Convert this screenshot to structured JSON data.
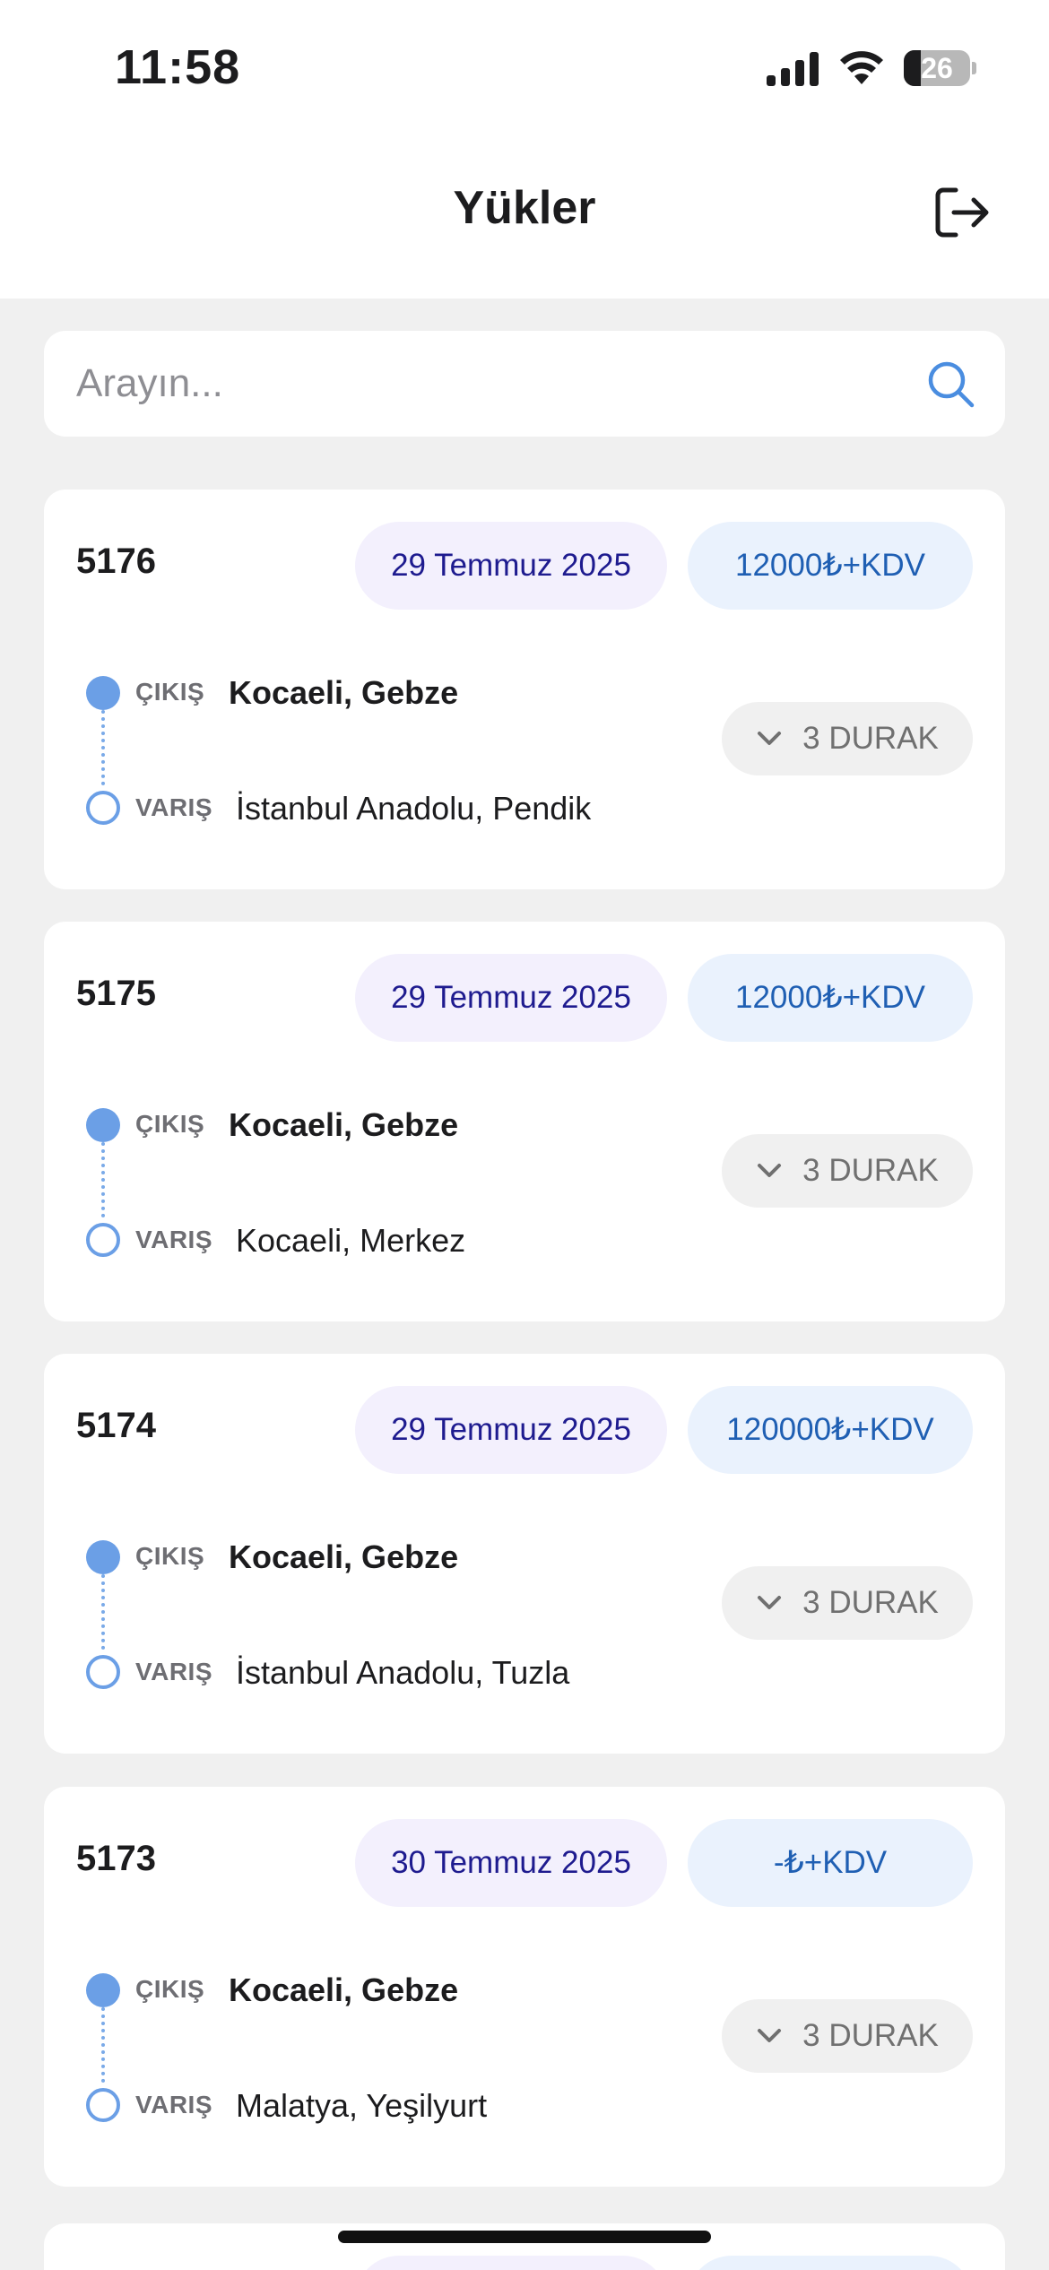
{
  "status_bar": {
    "time": "11:58",
    "battery": "26",
    "battery_level": 0.26,
    "icons": [
      "signal-icon",
      "wifi-icon",
      "battery-icon"
    ]
  },
  "header": {
    "title": "Yükler",
    "logout_icon": "logout-icon"
  },
  "search": {
    "placeholder": "Arayın...",
    "value": "",
    "icon": "search-icon"
  },
  "labels": {
    "origin": "ÇIKIŞ",
    "destination": "VARIŞ"
  },
  "colors": {
    "accent": "#6b9fe6",
    "date_badge_bg": "#f3f0fd",
    "date_badge_text": "#1e1b8f",
    "price_badge_bg": "#eaf2fd",
    "price_badge_text": "#1f5fb3"
  },
  "loads": [
    {
      "id": "5176",
      "date": "29 Temmuz 2025",
      "price": "12000₺+KDV",
      "origin_label": "ÇIKIŞ",
      "origin": "Kocaeli, Gebze",
      "dest_label": "VARIŞ",
      "destination": "İstanbul Anadolu, Pendik",
      "stops": "3 DURAK"
    },
    {
      "id": "5175",
      "date": "29 Temmuz 2025",
      "price": "12000₺+KDV",
      "origin_label": "ÇIKIŞ",
      "origin": "Kocaeli, Gebze",
      "dest_label": "VARIŞ",
      "destination": "Kocaeli, Merkez",
      "stops": "3 DURAK"
    },
    {
      "id": "5174",
      "date": "29 Temmuz 2025",
      "price": "120000₺+KDV",
      "origin_label": "ÇIKIŞ",
      "origin": "Kocaeli, Gebze",
      "dest_label": "VARIŞ",
      "destination": "İstanbul Anadolu, Tuzla",
      "stops": "3 DURAK"
    },
    {
      "id": "5173",
      "date": "30 Temmuz 2025",
      "price": "-₺+KDV",
      "origin_label": "ÇIKIŞ",
      "origin": "Kocaeli, Gebze",
      "dest_label": "VARIŞ",
      "destination": "Malatya, Yeşilyurt",
      "stops": "3 DURAK"
    }
  ]
}
